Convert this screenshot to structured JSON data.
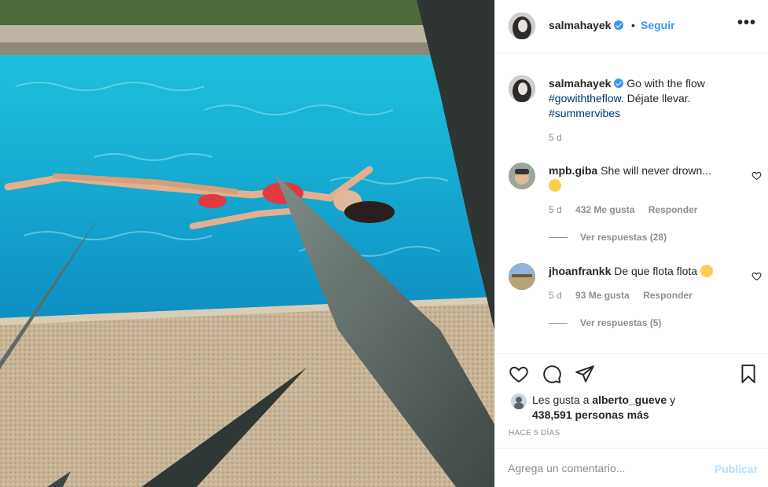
{
  "post": {
    "username": "salmahayek",
    "follow_label": "Seguir",
    "more_label": "•••",
    "separator": "•",
    "caption": {
      "username": "salmahayek",
      "text": "Go with the flow",
      "hashtag1": "#gowiththeflow",
      "text2": ". Déjate llevar.",
      "hashtag2": "#summervibes",
      "time": "5 d"
    },
    "comments": [
      {
        "username": "mpb.giba",
        "text": "She will never drown...",
        "time": "5 d",
        "likes": "432 Me gusta",
        "reply_label": "Responder",
        "view_replies": "Ver respuestas (28)"
      },
      {
        "username": "jhoanfrankk",
        "text": "De que flota flota",
        "time": "5 d",
        "likes": "93 Me gusta",
        "reply_label": "Responder",
        "view_replies": "Ver respuestas (5)"
      }
    ],
    "likes_line1_prefix": "Les gusta a ",
    "likes_user": "alberto_gueve",
    "likes_line1_suffix": " y",
    "likes_line2": "438,591 personas más",
    "posted_ago": "HACE 5 DÍAS",
    "comment_placeholder": "Agrega un comentario...",
    "publish_label": "Publicar"
  },
  "colors": {
    "accent": "#3897f0",
    "publish_disabled": "#b2dffc",
    "muted": "#8e8e8e",
    "pool": "#1fb3d6"
  },
  "icons": [
    "verified-badge-icon",
    "heart-icon",
    "comment-icon",
    "share-icon",
    "bookmark-icon",
    "more-options-icon"
  ]
}
